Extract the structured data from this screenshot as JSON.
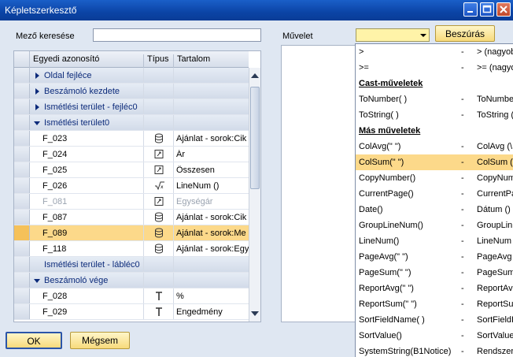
{
  "window": {
    "title": "Képletszerkesztő"
  },
  "search": {
    "label": "Mező keresése",
    "value": ""
  },
  "operation": {
    "label": "Művelet",
    "value": "",
    "insert_label": "Beszúrás"
  },
  "grid": {
    "headers": {
      "id": "Egyedi azonosító",
      "type": "Típus",
      "content": "Tartalom"
    },
    "rows": [
      {
        "id": "Oldal fejléce",
        "group": true,
        "expanded": false
      },
      {
        "id": "Beszámoló kezdete",
        "group": true,
        "expanded": false
      },
      {
        "id": "Ismétlési terület - fejléc0",
        "group": true,
        "expanded": false
      },
      {
        "id": "Ismétlési terület0",
        "group": true,
        "expanded": true
      },
      {
        "id": "F_023",
        "icon": "database-icon",
        "content": "Ajánlat - sorok:Cik"
      },
      {
        "id": "F_024",
        "icon": "formula-box-icon",
        "content": "Ár"
      },
      {
        "id": "F_025",
        "icon": "formula-box-icon",
        "content": "Összesen"
      },
      {
        "id": "F_026",
        "icon": "sqrt-icon",
        "content": "LineNum ()"
      },
      {
        "id": "F_081",
        "icon": "formula-box-icon",
        "content": "Egységár",
        "disabled": true
      },
      {
        "id": "F_087",
        "icon": "database-icon",
        "content": "Ajánlat - sorok:Cik"
      },
      {
        "id": "F_089",
        "icon": "database-icon",
        "content": "Ajánlat - sorok:Me",
        "selected": true
      },
      {
        "id": "F_118",
        "icon": "database-icon",
        "content": "Ajánlat - sorok:Egy"
      },
      {
        "id": "Ismétlési terület - lábléc0",
        "group": true,
        "expanded": null
      },
      {
        "id": "Beszámoló vége",
        "group": true,
        "expanded": true
      },
      {
        "id": "F_028",
        "icon": "text-icon",
        "content": "%"
      },
      {
        "id": "F_029",
        "icon": "text-icon",
        "content": "Engedmény"
      }
    ]
  },
  "operations": [
    {
      "name": ">",
      "dash": "-",
      "desc": "> (nagyob"
    },
    {
      "name": ">=",
      "dash": "-",
      "desc": ">= (nagyo"
    },
    {
      "name": "Cast-műveletek",
      "header": true
    },
    {
      "name": "ToNumber( )",
      "dash": "-",
      "desc": "ToNumbe"
    },
    {
      "name": "ToString( )",
      "dash": "-",
      "desc": "ToString ("
    },
    {
      "name": "Más műveletek",
      "header": true
    },
    {
      "name": "ColAvg(\" \")",
      "dash": "-",
      "desc": "ColAvg (\\"
    },
    {
      "name": "ColSum(\" \")",
      "dash": "-",
      "desc": "ColSum (",
      "selected": true
    },
    {
      "name": "CopyNumber()",
      "dash": "-",
      "desc": "CopyNum"
    },
    {
      "name": "CurrentPage()",
      "dash": "-",
      "desc": "CurrentPa"
    },
    {
      "name": "Date()",
      "dash": "-",
      "desc": "Dátum ()"
    },
    {
      "name": "GroupLineNum()",
      "dash": "-",
      "desc": "GroupLin"
    },
    {
      "name": "LineNum()",
      "dash": "-",
      "desc": "LineNum"
    },
    {
      "name": "PageAvg(\" \")",
      "dash": "-",
      "desc": "PageAvg ("
    },
    {
      "name": "PageSum(\" \")",
      "dash": "-",
      "desc": "PageSum"
    },
    {
      "name": "ReportAvg(\" \")",
      "dash": "-",
      "desc": "ReportAv"
    },
    {
      "name": "ReportSum(\" \")",
      "dash": "-",
      "desc": "ReportSu"
    },
    {
      "name": "SortFieldName( )",
      "dash": "-",
      "desc": "SortFieldI"
    },
    {
      "name": "SortValue()",
      "dash": "-",
      "desc": "SortValue"
    },
    {
      "name": "SystemString(B1Notice)",
      "dash": "-",
      "desc": "Rendszer"
    }
  ],
  "buttons": {
    "ok": "OK",
    "cancel": "Mégsem"
  },
  "colors": {
    "selection": "#fcd98a",
    "titlebar": "#0b44a6",
    "background": "#dfe7f2"
  }
}
